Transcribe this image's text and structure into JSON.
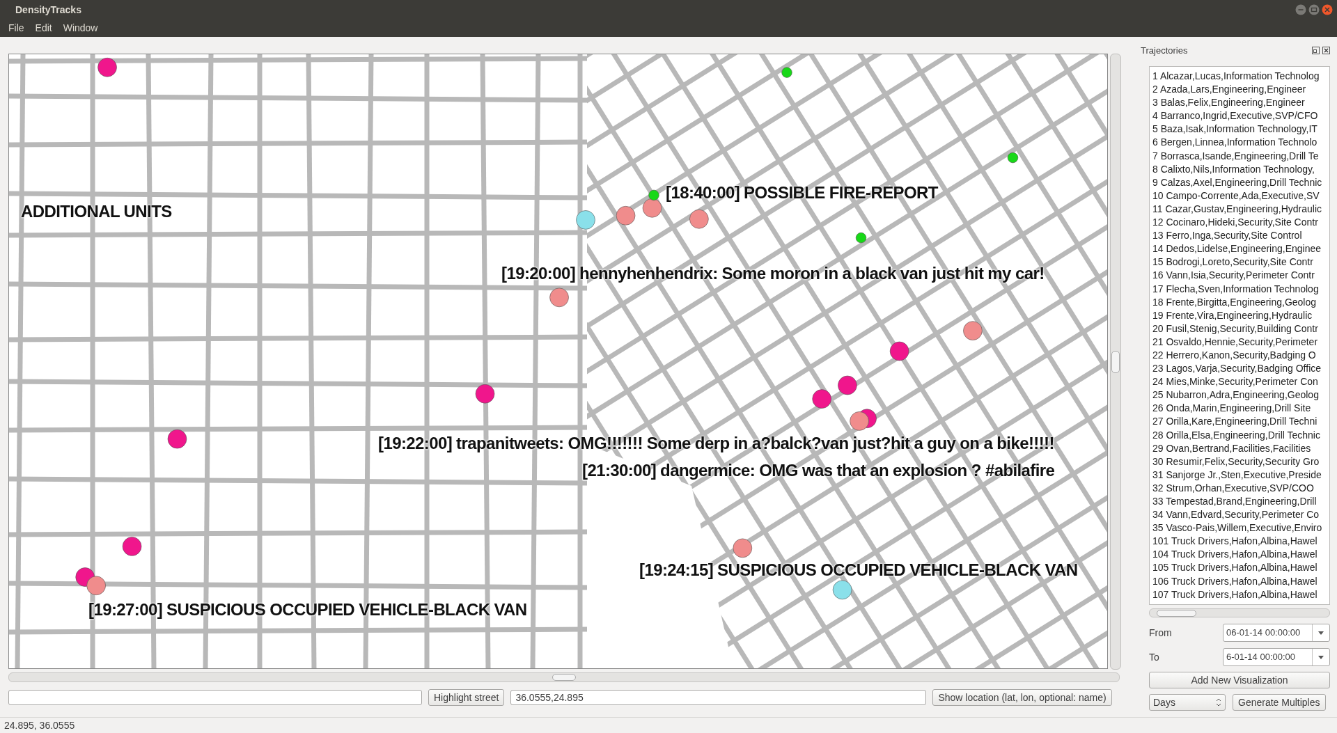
{
  "window": {
    "title": "DensityTracks"
  },
  "menu": [
    "File",
    "Edit",
    "Window"
  ],
  "map": {
    "labels": [
      "ADDITIONAL UNITS",
      "[18:40:00] POSSIBLE FIRE-REPORT",
      "[19:20:00] hennyhenhendrix: Some moron in a black van just hit my car!",
      "[19:22:00] trapanitweets: OMG!!!!!!! Some derp in a?balck?van just?hit a guy on a bike!!!!!",
      "[21:30:00] dangermice: OMG was that an explosion ? #abilafire",
      "[19:24:15] SUSPICIOUS OCCUPIED VEHICLE-BLACK VAN",
      "[19:27:00] SUSPICIOUS OCCUPIED VEHICLE-BLACK VAN"
    ],
    "markers": [
      {
        "color": "#f0168c"
      },
      {
        "color": "#f0168c"
      },
      {
        "color": "#f0168c"
      },
      {
        "color": "#f0168c"
      },
      {
        "color": "#f0168c"
      },
      {
        "color": "#f0168c"
      },
      {
        "color": "#f0168c"
      },
      {
        "color": "#f0168c"
      },
      {
        "color": "#f0168c"
      },
      {
        "color": "#f08c8c"
      },
      {
        "color": "#f08c8c"
      },
      {
        "color": "#f08c8c"
      },
      {
        "color": "#f08c8c"
      },
      {
        "color": "#f08c8c"
      },
      {
        "color": "#f08c8c"
      },
      {
        "color": "#f08c8c"
      },
      {
        "color": "#f08c8c"
      },
      {
        "color": "#8ae0ea"
      },
      {
        "color": "#8ae0ea"
      },
      {
        "color": "#18d818"
      },
      {
        "color": "#18d818"
      },
      {
        "color": "#18d818"
      },
      {
        "color": "#18d818"
      }
    ]
  },
  "bottom_bar": {
    "highlight_button": "Highlight street",
    "location_field": {
      "value": "36.0555,24.895"
    },
    "show_button": "Show location (lat, lon, optional: name)"
  },
  "status_bar": "24.895, 36.0555",
  "dock": {
    "title": "Trajectories",
    "items": [
      "1 Alcazar,Lucas,Information Technolog",
      "2 Azada,Lars,Engineering,Engineer",
      "3 Balas,Felix,Engineering,Engineer",
      "4 Barranco,Ingrid,Executive,SVP/CFO",
      "5 Baza,Isak,Information Technology,IT",
      "6 Bergen,Linnea,Information Technolo",
      "7 Borrasca,Isande,Engineering,Drill Te",
      "8 Calixto,Nils,Information Technology,",
      "9 Calzas,Axel,Engineering,Drill Technic",
      "10 Campo-Corrente,Ada,Executive,SV",
      "11 Cazar,Gustav,Engineering,Hydraulic",
      "12 Cocinaro,Hideki,Security,Site Contr",
      "13 Ferro,Inga,Security,Site Control",
      "14 Dedos,Lidelse,Engineering,Enginee",
      "15 Bodrogi,Loreto,Security,Site Contr",
      "16 Vann,Isia,Security,Perimeter Contr",
      "17 Flecha,Sven,Information Technolog",
      "18 Frente,Birgitta,Engineering,Geolog",
      "19 Frente,Vira,Engineering,Hydraulic",
      "20 Fusil,Stenig,Security,Building Contr",
      "21 Osvaldo,Hennie,Security,Perimeter",
      "22 Herrero,Kanon,Security,Badging O",
      "23 Lagos,Varja,Security,Badging Office",
      "24 Mies,Minke,Security,Perimeter Con",
      "25 Nubarron,Adra,Engineering,Geolog",
      "26 Onda,Marin,Engineering,Drill Site",
      "27 Orilla,Kare,Engineering,Drill Techni",
      "28 Orilla,Elsa,Engineering,Drill Technic",
      "29 Ovan,Bertrand,Facilities,Facilities",
      "30 Resumir,Felix,Security,Security Gro",
      "31 Sanjorge Jr.,Sten,Executive,Preside",
      "32 Strum,Orhan,Executive,SVP/COO",
      "33 Tempestad,Brand,Engineering,Drill",
      "34 Vann,Edvard,Security,Perimeter Co",
      "35 Vasco-Pais,Willem,Executive,Enviro",
      "101 Truck Drivers,Hafon,Albina,Hawel",
      "104 Truck Drivers,Hafon,Albina,Hawel",
      "105 Truck Drivers,Hafon,Albina,Hawel",
      "106 Truck Drivers,Hafon,Albina,Hawel",
      "107 Truck Drivers,Hafon,Albina,Hawel"
    ],
    "from": {
      "label": "From",
      "value": "06-01-14 00:00:00"
    },
    "to": {
      "label": "To",
      "value": "6-01-14 00:00:00"
    },
    "add_button": "Add New Visualization",
    "unit_select": {
      "value": "Days"
    },
    "generate_button": "Generate Multiples"
  }
}
